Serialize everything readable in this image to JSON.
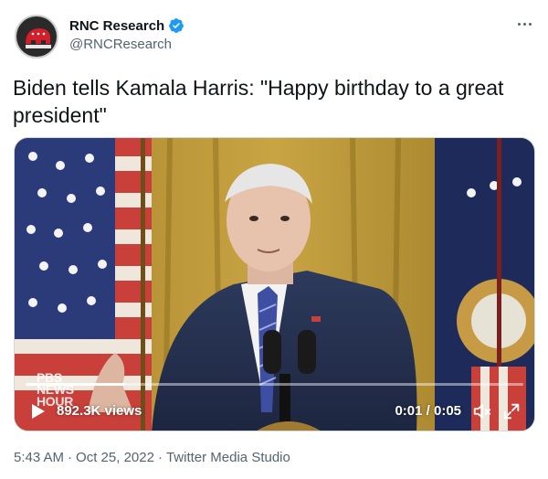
{
  "author": {
    "display_name": "RNC Research",
    "handle": "@RNCResearch",
    "verified": true,
    "avatar_icon": "rnc-elephant-logo"
  },
  "more_icon": "more-dots-icon",
  "tweet_text": "Biden tells Kamala Harris: \"Happy birthday to a great president\"",
  "video": {
    "watermark": "PBS NEWS HOUR",
    "watermark_lines": [
      "PBS",
      "NEWS",
      "HOUR"
    ],
    "views": "892.3K views",
    "time": "0:01 / 0:05",
    "progress": 0.2,
    "play_icon": "play-icon",
    "mute_icon": "muted-speaker-icon",
    "fullscreen_icon": "fullscreen-icon"
  },
  "meta": {
    "time": "5:43 AM",
    "sep1": "·",
    "date": "Oct 25, 2022",
    "sep2": "·",
    "source": "Twitter Media Studio"
  },
  "colors": {
    "verified": "#1d9bf0",
    "secondary_text": "#536471",
    "primary_text": "#0f1419"
  }
}
